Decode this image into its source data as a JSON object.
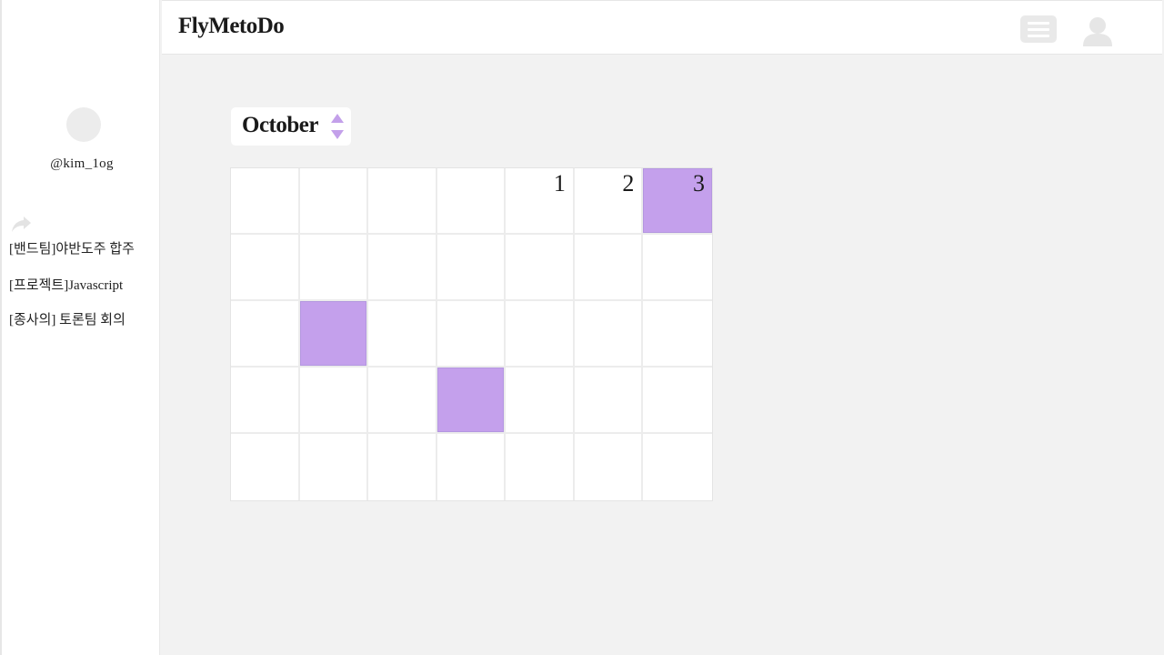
{
  "app": {
    "title": "FlyMetoDo"
  },
  "sidebar": {
    "username": "@kim_1og",
    "icon": "share-icon",
    "projects": [
      "[밴드팀]야반도주 합주",
      "[프로젝트]Javascript",
      "[종사의] 토론팀 회의"
    ]
  },
  "header": {
    "icons": [
      "menu-icon",
      "user-icon"
    ]
  },
  "calendar": {
    "month": "October",
    "weeks": [
      [
        "",
        "",
        "",
        "",
        "1",
        "2",
        "3"
      ],
      [
        "",
        "",
        "",
        "",
        "",
        "",
        ""
      ],
      [
        "",
        "",
        "",
        "",
        "",
        "",
        ""
      ],
      [
        "",
        "",
        "",
        "",
        "",
        "",
        ""
      ],
      [
        "",
        "",
        "",
        "",
        "",
        "",
        ""
      ]
    ],
    "highlighted_cells": [
      [
        0,
        6
      ],
      [
        2,
        1
      ],
      [
        3,
        3
      ]
    ],
    "highlight_color": "#c4a0ec"
  },
  "colors": {
    "background": "#f2f2f2",
    "accent": "#c4a0ec",
    "arrow": "#c3a0ea"
  }
}
